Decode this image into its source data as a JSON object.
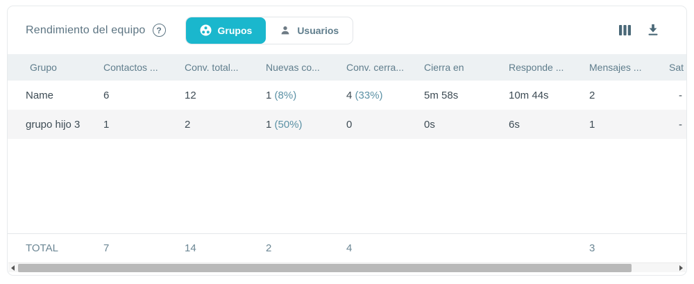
{
  "header": {
    "title": "Rendimiento del equipo",
    "help_icon": "question-circle-icon",
    "help_glyph": "?",
    "tabs": [
      {
        "label": "Grupos",
        "icon": "groups-icon",
        "active": true
      },
      {
        "label": "Usuarios",
        "icon": "user-icon",
        "active": false
      }
    ],
    "actions": [
      {
        "name": "columns-icon"
      },
      {
        "name": "download-icon"
      }
    ],
    "accent_color": "#1ab7cd"
  },
  "table": {
    "columns": [
      "Grupo",
      "Contactos ...",
      "Conv. total...",
      "Nuevas co...",
      "Conv. cerra...",
      "Cierra en",
      "Responde ...",
      "Mensajes ...",
      "Sat"
    ],
    "rows": [
      {
        "cells": [
          [
            "Name"
          ],
          [
            "6"
          ],
          [
            "12"
          ],
          [
            "1 ",
            "(8%)"
          ],
          [
            "4 ",
            "(33%)"
          ],
          [
            "5m 58s"
          ],
          [
            "10m 44s"
          ],
          [
            "2"
          ],
          [
            "-"
          ]
        ]
      },
      {
        "cells": [
          [
            "grupo hijo 3"
          ],
          [
            "1"
          ],
          [
            "2"
          ],
          [
            "1 ",
            "(50%)"
          ],
          [
            "0"
          ],
          [
            "0s"
          ],
          [
            "6s"
          ],
          [
            "1"
          ],
          [
            "-"
          ]
        ]
      }
    ],
    "total_row": {
      "cells": [
        [
          "TOTAL"
        ],
        [
          "7"
        ],
        [
          "14"
        ],
        [
          "2"
        ],
        [
          "4"
        ],
        [
          ""
        ],
        [
          ""
        ],
        [
          "3"
        ],
        [
          ""
        ]
      ]
    },
    "percent_color": "#5b91a5"
  },
  "scrollbar": {
    "orientation": "horizontal"
  }
}
